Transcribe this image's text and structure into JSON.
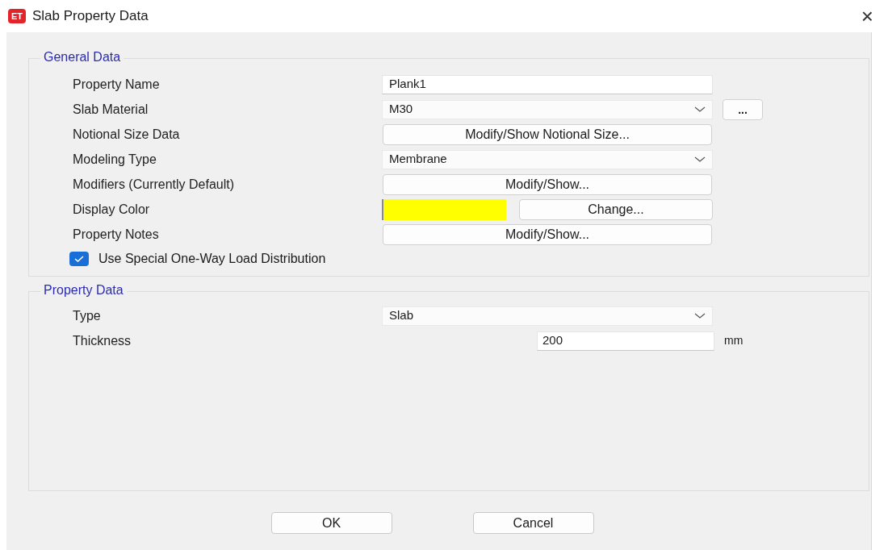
{
  "window": {
    "logo_text": "ET",
    "title": "Slab Property Data",
    "close": "×"
  },
  "general_data": {
    "title": "General Data",
    "rows": [
      {
        "label": "Property Name",
        "kind": "text",
        "value": "Plank1"
      },
      {
        "label": "Slab Material",
        "kind": "dropdown",
        "value": "M30",
        "extra_button": "..."
      },
      {
        "label": "Notional Size Data",
        "kind": "button",
        "button": "Modify/Show Notional Size..."
      },
      {
        "label": "Modeling Type",
        "kind": "dropdown",
        "value": "Membrane"
      },
      {
        "label": "Modifiers (Currently Default)",
        "kind": "button",
        "button": "Modify/Show..."
      },
      {
        "label": "Display Color",
        "kind": "color",
        "color": "#ffff00",
        "button": "Change..."
      },
      {
        "label": "Property Notes",
        "kind": "button",
        "button": "Modify/Show..."
      }
    ],
    "checkbox": {
      "label": "Use Special One-Way Load Distribution",
      "checked": true
    }
  },
  "property_data": {
    "title": "Property Data",
    "rows": [
      {
        "label": "Type",
        "kind": "dropdown",
        "value": "Slab"
      },
      {
        "label": "Thickness",
        "kind": "number",
        "value": "200",
        "unit": "mm"
      }
    ]
  },
  "buttons": [
    "OK",
    "Cancel"
  ]
}
